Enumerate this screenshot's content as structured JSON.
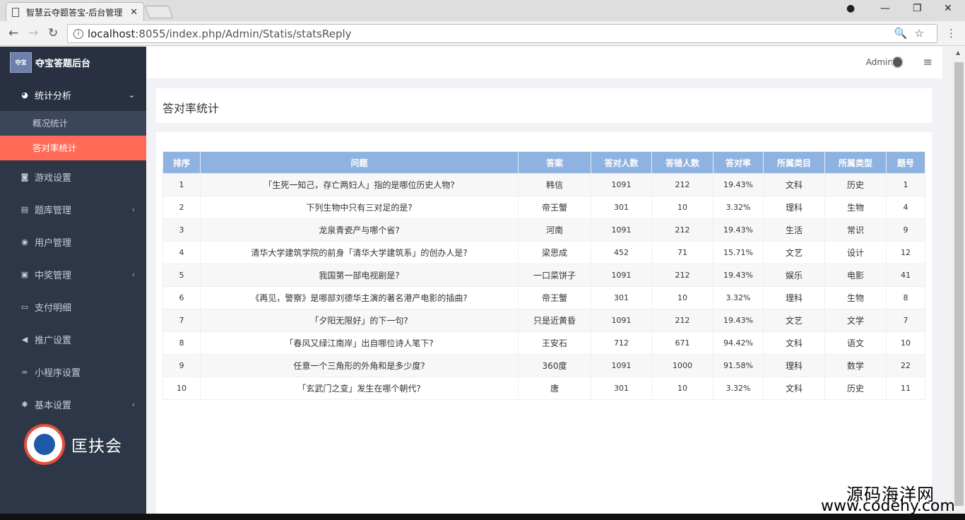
{
  "browser": {
    "tab_title": "智慧云夺题答宝-后台管理",
    "tab_close": "✕",
    "url_host": "localhost",
    "url_rest": ":8055/index.php/Admin/Statis/statsReply"
  },
  "sidebar": {
    "brand": "夺宝答题后台",
    "items": [
      {
        "label": "统计分析",
        "icon": "pie-chart-icon",
        "open": true
      },
      {
        "label": "游戏设置",
        "icon": "gamepad-icon"
      },
      {
        "label": "题库管理",
        "icon": "list-icon",
        "arrow": true
      },
      {
        "label": "用户管理",
        "icon": "user-icon"
      },
      {
        "label": "中奖管理",
        "icon": "prize-icon",
        "arrow": true
      },
      {
        "label": "支付明细",
        "icon": "card-icon"
      },
      {
        "label": "推广设置",
        "icon": "bullhorn-icon"
      },
      {
        "label": "小程序设置",
        "icon": "link-icon"
      },
      {
        "label": "基本设置",
        "icon": "gear-icon",
        "arrow": true
      }
    ],
    "sub_items": [
      "概况统计",
      "答对率统计"
    ],
    "footer_logo": "匡扶会"
  },
  "topbar": {
    "user": "Admin"
  },
  "page": {
    "title": "答对率统计"
  },
  "table": {
    "headers": [
      "排序",
      "问题",
      "答案",
      "答对人数",
      "答错人数",
      "答对率",
      "所属类目",
      "所属类型",
      "题号"
    ],
    "rows": [
      [
        "1",
        "「生死一知己，存亡两妇人」指的是哪位历史人物?",
        "韩信",
        "1091",
        "212",
        "19.43%",
        "文科",
        "历史",
        "1"
      ],
      [
        "2",
        "下列生物中只有三对足的是?",
        "帝王蟹",
        "301",
        "10",
        "3.32%",
        "理科",
        "生物",
        "4"
      ],
      [
        "3",
        "龙泉青瓷产与哪个省?",
        "河南",
        "1091",
        "212",
        "19.43%",
        "生活",
        "常识",
        "9"
      ],
      [
        "4",
        "清华大学建筑学院的前身「清华大学建筑系」的创办人是?",
        "梁思成",
        "452",
        "71",
        "15.71%",
        "文艺",
        "设计",
        "12"
      ],
      [
        "5",
        "我国第一部电视剧是?",
        "一口菜饼子",
        "1091",
        "212",
        "19.43%",
        "娱乐",
        "电影",
        "41"
      ],
      [
        "6",
        "《再见，警察》是哪部刘德华主演的著名港产电影的插曲?",
        "帝王蟹",
        "301",
        "10",
        "3.32%",
        "理科",
        "生物",
        "8"
      ],
      [
        "7",
        "「夕阳无限好」的下一句?",
        "只是近黄昏",
        "1091",
        "212",
        "19.43%",
        "文艺",
        "文学",
        "7"
      ],
      [
        "8",
        "「春风又绿江南岸」出自哪位诗人笔下?",
        "王安石",
        "712",
        "671",
        "94.42%",
        "文科",
        "语文",
        "10"
      ],
      [
        "9",
        "任意一个三角形的外角和是多少度?",
        "360度",
        "1091",
        "1000",
        "91.58%",
        "理科",
        "数学",
        "22"
      ],
      [
        "10",
        "「玄武门之变」发生在哪个朝代?",
        "唐",
        "301",
        "10",
        "3.32%",
        "文科",
        "历史",
        "11"
      ]
    ]
  },
  "watermark": {
    "line1": "源码海洋网",
    "line2": "www.codehy.com"
  },
  "colors": {
    "sidebar": "#2e3748",
    "active": "#ff6b57",
    "table_header": "#8fb3e0"
  }
}
